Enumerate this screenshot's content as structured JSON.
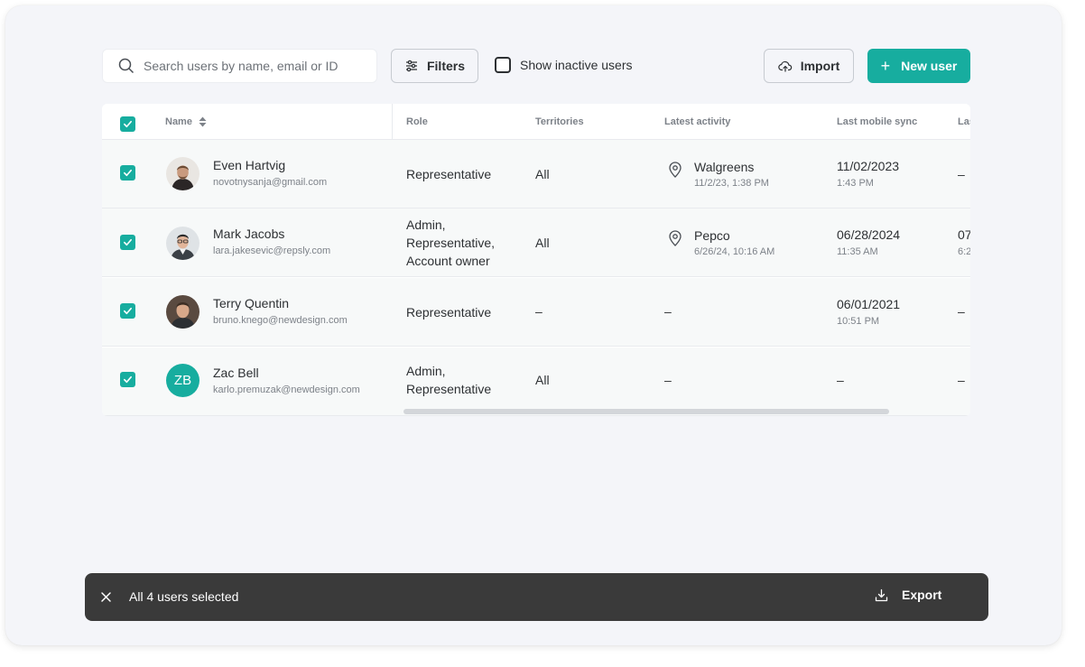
{
  "toolbar": {
    "search_placeholder": "Search users by name, email or ID",
    "filters_label": "Filters",
    "show_inactive_label": "Show inactive users",
    "show_inactive_checked": false,
    "import_label": "Import",
    "new_user_label": "New user",
    "new_user_icon": "+"
  },
  "table": {
    "columns": [
      "Name",
      "Role",
      "Territories",
      "Latest activity",
      "Last mobile sync",
      "Las"
    ],
    "header_checkbox_checked": true,
    "rows": [
      {
        "checked": true,
        "avatar_type": "photo",
        "name": "Even Hartvig",
        "email": "novotnysanja@gmail.com",
        "role_lines": [
          "Representative"
        ],
        "territories": "All",
        "activity_name": "Walgreens",
        "activity_time": "11/2/23, 1:38 PM",
        "sync_date": "11/02/2023",
        "sync_time": "1:43 PM",
        "last_col": "–",
        "last_col_sub": ""
      },
      {
        "checked": true,
        "avatar_type": "photo",
        "name": "Mark Jacobs",
        "email": "lara.jakesevic@repsly.com",
        "role_lines": [
          "Admin,",
          "Representative,",
          "Account owner"
        ],
        "territories": "All",
        "activity_name": "Pepco",
        "activity_time": "6/26/24, 10:16 AM",
        "sync_date": "06/28/2024",
        "sync_time": "11:35 AM",
        "last_col": "07",
        "last_col_sub": "6:2"
      },
      {
        "checked": true,
        "avatar_type": "photo",
        "name": "Terry Quentin",
        "email": "bruno.knego@newdesign.com",
        "role_lines": [
          "Representative"
        ],
        "territories": "–",
        "activity_name": "–",
        "activity_time": "",
        "sync_date": "06/01/2021",
        "sync_time": "10:51 PM",
        "last_col": "–",
        "last_col_sub": ""
      },
      {
        "checked": true,
        "avatar_type": "initials",
        "initials": "ZB",
        "name": "Zac Bell",
        "email": "karlo.premuzak@newdesign.com",
        "role_lines": [
          "Admin,",
          "Representative"
        ],
        "territories": "All",
        "activity_name": "–",
        "activity_time": "",
        "sync_date": "–",
        "sync_time": "",
        "last_col": "–",
        "last_col_sub": ""
      }
    ]
  },
  "bottom_bar": {
    "selection_text": "All 4 users selected",
    "export_label": "Export"
  },
  "colors": {
    "accent": "#17ad9f",
    "background": "#f4f5f9",
    "bottom_bar": "#3a3a3a"
  }
}
